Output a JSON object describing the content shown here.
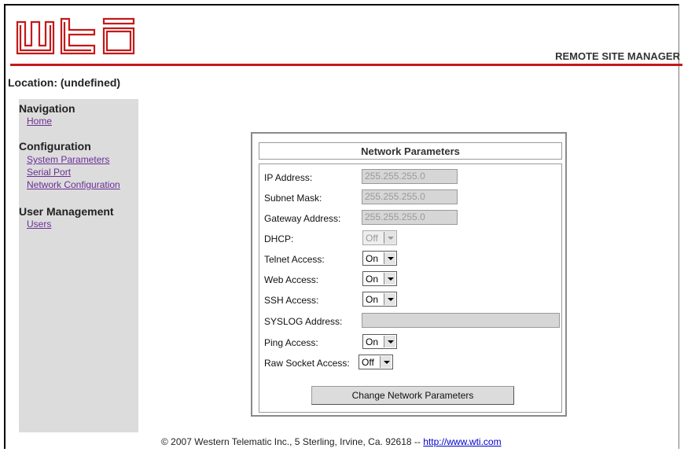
{
  "header": {
    "logo_text": "wti",
    "app_title": "REMOTE SITE MANAGER",
    "brand_color": "#c41919"
  },
  "location": {
    "label": "Location:",
    "value": "(undefined)"
  },
  "sidebar": {
    "navigation": {
      "heading": "Navigation",
      "items": [
        "Home"
      ]
    },
    "configuration": {
      "heading": "Configuration",
      "items": [
        "System Parameters",
        "Serial Port",
        "Network Configuration"
      ]
    },
    "user_management": {
      "heading": "User Management",
      "items": [
        "Users"
      ]
    }
  },
  "panel": {
    "title": "Network Parameters",
    "fields": {
      "ip_address": {
        "label": "IP Address:",
        "value": "255.255.255.0"
      },
      "subnet_mask": {
        "label": "Subnet Mask:",
        "value": "255.255.255.0"
      },
      "gateway_address": {
        "label": "Gateway Address:",
        "value": "255.255.255.0"
      },
      "dhcp": {
        "label": "DHCP:",
        "value": "Off"
      },
      "telnet_access": {
        "label": "Telnet Access:",
        "value": "On"
      },
      "web_access": {
        "label": "Web Access:",
        "value": "On"
      },
      "ssh_access": {
        "label": "SSH Access:",
        "value": "On"
      },
      "syslog_address": {
        "label": "SYSLOG Address:",
        "value": ""
      },
      "ping_access": {
        "label": "Ping Access:",
        "value": "On"
      },
      "raw_socket_access": {
        "label": "Raw Socket Access:",
        "value": "Off"
      }
    },
    "submit_label": "Change Network Parameters"
  },
  "footer": {
    "text": "© 2007 Western Telematic Inc., 5 Sterling, Irvine, Ca. 92618 -- ",
    "link_text": "http://www.wti.com"
  }
}
